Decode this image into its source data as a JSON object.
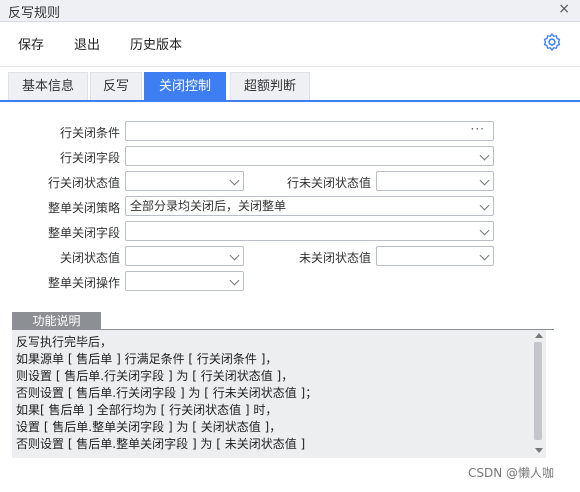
{
  "window": {
    "title": "反写规则",
    "close": "×"
  },
  "toolbar": {
    "save": "保存",
    "exit": "退出",
    "history": "历史版本",
    "settings_icon": "gear-icon"
  },
  "tabs": [
    {
      "label": "基本信息"
    },
    {
      "label": "反写"
    },
    {
      "label": "关闭控制",
      "active": true
    },
    {
      "label": "超额判断"
    }
  ],
  "form": {
    "row_close_condition": {
      "label": "行关闭条件",
      "value": "",
      "button": "···"
    },
    "row_close_field": {
      "label": "行关闭字段",
      "value": ""
    },
    "row_closed_value": {
      "label": "行关闭状态值",
      "value": ""
    },
    "row_unclosed_value": {
      "label": "行未关闭状态值",
      "value": ""
    },
    "whole_close_strategy": {
      "label": "整单关闭策略",
      "value": "全部分录均关闭后，关闭整单"
    },
    "whole_close_field": {
      "label": "整单关闭字段",
      "value": ""
    },
    "closed_value": {
      "label": "关闭状态值",
      "value": ""
    },
    "unclosed_value": {
      "label": "未关闭状态值",
      "value": ""
    },
    "whole_close_op": {
      "label": "整单关闭操作",
      "value": ""
    }
  },
  "desc": {
    "title": "功能说明",
    "lines": [
      "反写执行完毕后，",
      "如果源单 [ 售后单 ] 行满足条件 [ 行关闭条件 ]，",
      "则设置 [ 售后单.行关闭字段 ] 为 [ 行关闭状态值 ]，",
      "否则设置 [ 售后单.行关闭字段 ] 为 [ 行未关闭状态值 ]；",
      "",
      "如果[ 售后单 ] 全部行均为 [ 行关闭状态值 ] 时，",
      "设置 [ 售后单.整单关闭字段 ] 为 [ 关闭状态值 ]，",
      "否则设置 [ 售后单.整单关闭字段 ] 为 [ 未关闭状态值 ]"
    ]
  },
  "watermark": "CSDN @懒人咖"
}
